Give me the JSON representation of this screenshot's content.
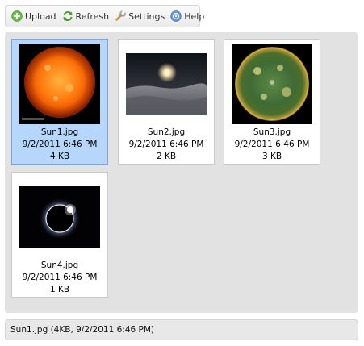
{
  "toolbar": {
    "upload_label": "Upload",
    "refresh_label": "Refresh",
    "settings_label": "Settings",
    "help_label": "Help"
  },
  "files": [
    {
      "name": "Sun1.jpg",
      "date": "9/2/2011 6:46 PM",
      "size": "4 KB",
      "selected": true,
      "icon": "sun-solar-disk-orange"
    },
    {
      "name": "Sun2.jpg",
      "date": "9/2/2011 6:46 PM",
      "size": "2 KB",
      "selected": false,
      "icon": "sun-over-clouds"
    },
    {
      "name": "Sun3.jpg",
      "date": "9/2/2011 6:46 PM",
      "size": "3 KB",
      "selected": false,
      "icon": "sun-green-disk"
    },
    {
      "name": "Sun4.jpg",
      "date": "9/2/2011 6:46 PM",
      "size": "1 KB",
      "selected": false,
      "icon": "solar-eclipse"
    }
  ],
  "status": {
    "text": "Sun1.jpg (4KB, 9/2/2011 6:46 PM)"
  },
  "colors": {
    "selected_bg": "#b6d6fb",
    "selected_border": "#7aa6e0",
    "panel_bg": "#e2e2e2"
  }
}
